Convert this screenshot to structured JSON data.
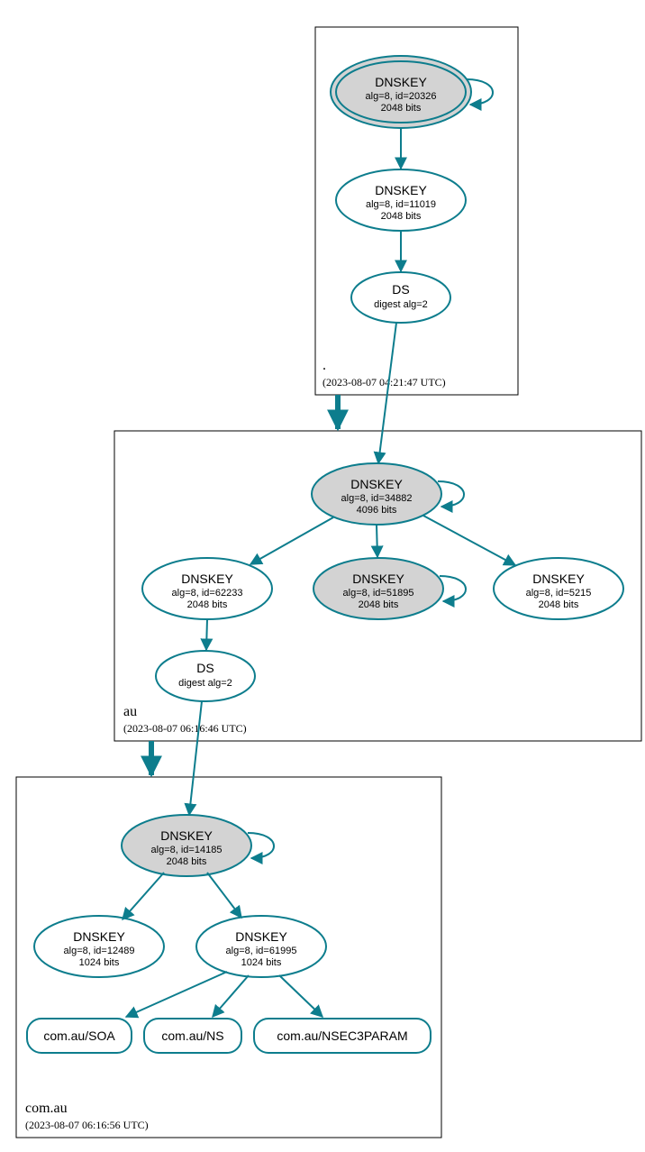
{
  "colors": {
    "accent": "#0d7d8d",
    "shade": "#d3d3d3"
  },
  "zones": {
    "root": {
      "name": ".",
      "ts": "(2023-08-07 04:21:47 UTC)"
    },
    "au": {
      "name": "au",
      "ts": "(2023-08-07 06:16:46 UTC)"
    },
    "comau": {
      "name": "com.au",
      "ts": "(2023-08-07 06:16:56 UTC)"
    }
  },
  "nodes": {
    "root_ksk": {
      "t": "DNSKEY",
      "s1": "alg=8, id=20326",
      "s2": "2048 bits"
    },
    "root_zsk": {
      "t": "DNSKEY",
      "s1": "alg=8, id=11019",
      "s2": "2048 bits"
    },
    "root_ds": {
      "t": "DS",
      "s1": "digest alg=2"
    },
    "au_ksk": {
      "t": "DNSKEY",
      "s1": "alg=8, id=34882",
      "s2": "4096 bits"
    },
    "au_k1": {
      "t": "DNSKEY",
      "s1": "alg=8, id=62233",
      "s2": "2048 bits"
    },
    "au_k2": {
      "t": "DNSKEY",
      "s1": "alg=8, id=51895",
      "s2": "2048 bits"
    },
    "au_k3": {
      "t": "DNSKEY",
      "s1": "alg=8, id=5215",
      "s2": "2048 bits"
    },
    "au_ds": {
      "t": "DS",
      "s1": "digest alg=2"
    },
    "c_ksk": {
      "t": "DNSKEY",
      "s1": "alg=8, id=14185",
      "s2": "2048 bits"
    },
    "c_k1": {
      "t": "DNSKEY",
      "s1": "alg=8, id=12489",
      "s2": "1024 bits"
    },
    "c_k2": {
      "t": "DNSKEY",
      "s1": "alg=8, id=61995",
      "s2": "1024 bits"
    },
    "rr_soa": {
      "t": "com.au/SOA"
    },
    "rr_ns": {
      "t": "com.au/NS"
    },
    "rr_nsec": {
      "t": "com.au/NSEC3PARAM"
    }
  }
}
